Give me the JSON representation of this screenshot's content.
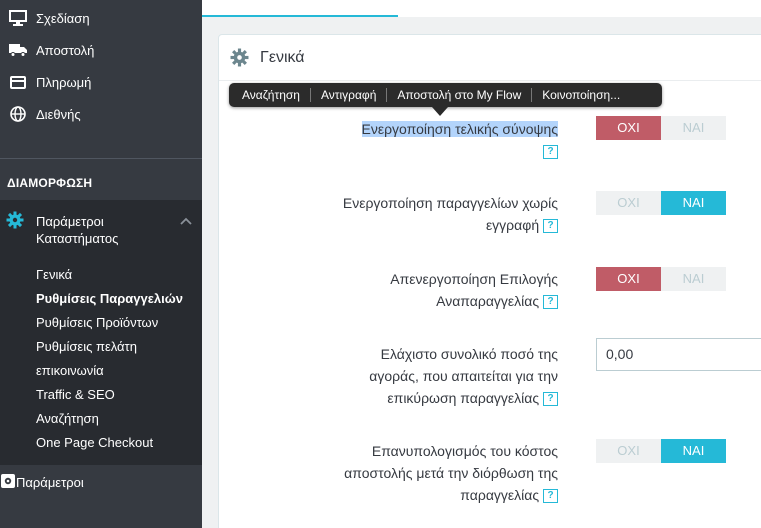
{
  "sidebar": {
    "top_items": [
      {
        "label": "Σχεδίαση",
        "icon": "monitor-icon"
      },
      {
        "label": "Αποστολή",
        "icon": "truck-icon"
      },
      {
        "label": "Πληρωμή",
        "icon": "credit-card-icon"
      },
      {
        "label": "Διεθνής",
        "icon": "globe-icon"
      }
    ],
    "section_title": "ΔΙΑΜΟΡΦΩΣΗ",
    "active_parent": {
      "label_line1": "Παράμετροι",
      "label_line2": "Καταστήματος",
      "icon": "gear-icon"
    },
    "submenu": [
      {
        "label": "Γενικά"
      },
      {
        "label": "Ρυθμίσεις Παραγγελιών",
        "active": true
      },
      {
        "label": "Ρυθμίσεις Προϊόντων"
      },
      {
        "label": "Ρυθμίσεις πελάτη"
      },
      {
        "label": "επικοινωνία"
      },
      {
        "label": "Traffic & SEO"
      },
      {
        "label": "Αναζήτηση"
      },
      {
        "label": "One Page Checkout"
      }
    ],
    "bottom_item": {
      "label": "Παράμετροι",
      "icon": "puzzle-gear-icon"
    }
  },
  "panel": {
    "title": "Γενικά",
    "icon": "gear-icon"
  },
  "context_menu": {
    "items": [
      "Αναζήτηση",
      "Αντιγραφή",
      "Αποστολή στο My Flow",
      "Κοινοποίηση..."
    ]
  },
  "form": {
    "help_glyph": "?",
    "switch_no": "ΟΧΙ",
    "switch_yes": "ΝΑΙ",
    "rows": [
      {
        "lines": [
          "Ενεργοποίηση τελικής σύνοψης"
        ],
        "value": "no"
      },
      {
        "lines": [
          "Ενεργοποίηση παραγγελίων χωρίς",
          "εγγραφή"
        ],
        "value": "yes"
      },
      {
        "lines": [
          "Απενεργοποίηση Επιλογής",
          "Αναπαραγγελίας"
        ],
        "value": "no"
      },
      {
        "lines": [
          "Ελάχιστο συνολικό ποσό της",
          "αγοράς, που απαιτείται για την",
          "επικύρωση παραγγελίας"
        ],
        "input_value": "0,00"
      },
      {
        "lines": [
          "Επανυπολογισμός του κόστος",
          "αποστολής μετά την διόρθωση της",
          "παραγγελίας"
        ],
        "value": "yes"
      }
    ]
  },
  "colors": {
    "sidebar_bg": "#363a41",
    "accent": "#25b9d7",
    "no_active": "#c05c67"
  }
}
